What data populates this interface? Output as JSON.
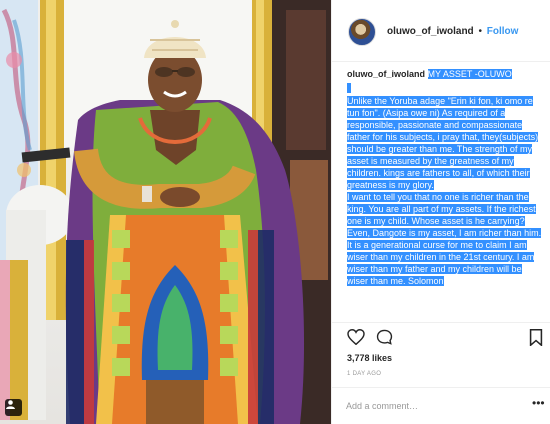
{
  "post": {
    "photo_alt": "",
    "username": "oluwo_of_iwoland",
    "separator": "•",
    "follow_label": "Follow"
  },
  "caption": {
    "username": "oluwo_of_iwoland",
    "title": "MY ASSET -OLUWO",
    "paragraph1": "Unlike the Yoruba adage \"Erin ki fon, ki omo re tun fon\". (Asipa owe ni) As required of a responsible, passionate and compassionate father for his subjects, i pray that, they(subjects) should be greater than me. The strength of my asset is measured by the greatness of my children. kings are fathers to all, of which their greatness is my glory.",
    "paragraph2": "I want to tell you that no one is richer than the king. You are all part of my assets. If the richest one is my child. Whose asset is he carrying? Even, Dangote is my asset, I am richer than him.",
    "paragraph3": "It is a generational curse for me to claim I am wiser than my children in the 21st century. I am wiser than my father and my children will be wiser than me. Solomon"
  },
  "actions": {
    "likes": "3,778 likes",
    "time": "1 DAY AGO",
    "comment_placeholder": "Add a comment…",
    "more_label": "•••"
  },
  "icons": {
    "user_tag": "person-tag-icon",
    "heart": "heart-icon",
    "comment": "comment-bubble-icon",
    "bookmark": "bookmark-icon",
    "more": "more-dots-icon"
  },
  "colors": {
    "selection": "#3390ff",
    "follow": "#3897f0",
    "gold": "#d9b13a",
    "throne_white": "#f7f7f4"
  }
}
